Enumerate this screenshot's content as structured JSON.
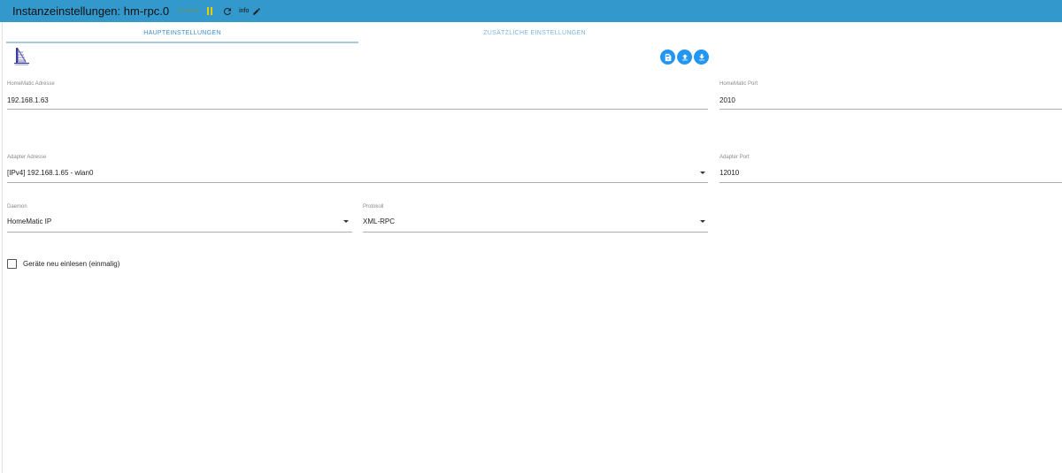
{
  "header": {
    "title": "Instanzeinstellungen: hm-rpc.0",
    "version": "v1.16.24",
    "info_label": "info",
    "icons": {
      "pause": "pause-icon",
      "reload": "reload-icon",
      "edit": "pencil-icon"
    }
  },
  "tabs": [
    {
      "label": "HAUPTEINSTELLUNGEN",
      "active": true
    },
    {
      "label": "ZUSÄTZLICHE EINSTELLUNGEN",
      "active": false
    }
  ],
  "actions": {
    "icons": [
      "save-file-icon",
      "upload-icon",
      "download-icon"
    ]
  },
  "form": {
    "homematic_address": {
      "label": "HomeMatic Adresse",
      "value": "192.168.1.63"
    },
    "homematic_port": {
      "label": "HomeMatic Port",
      "value": "2010"
    },
    "adapter_address": {
      "label": "Adapter Adresse",
      "value": "[IPv4] 192.168.1.65 - wlan0"
    },
    "adapter_port": {
      "label": "Adapter Port",
      "value": "12010"
    },
    "daemon": {
      "label": "Daemon",
      "value": "HomeMatic IP"
    },
    "protocol": {
      "label": "Protokoll",
      "value": "XML-RPC"
    },
    "reread_devices": {
      "label": "Geräte neu einlesen (einmalig)",
      "checked": false
    }
  },
  "colors": {
    "header_bg": "#3399cc",
    "accent": "#2196f3",
    "tab_text": "#3a8cc9"
  }
}
